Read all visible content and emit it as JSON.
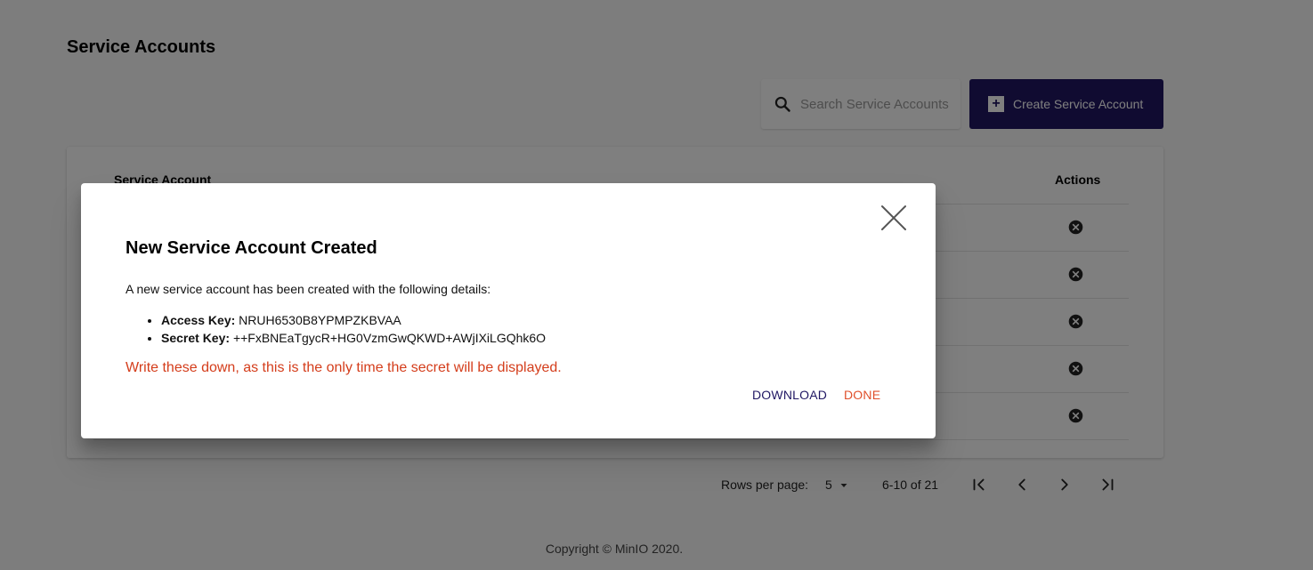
{
  "page": {
    "title": "Service Accounts"
  },
  "search": {
    "placeholder": "Search Service Accounts"
  },
  "toolbar": {
    "create_label": "Create Service Account"
  },
  "table": {
    "headers": {
      "account": "Service Account",
      "actions": "Actions"
    },
    "row_count_visible": 5
  },
  "pagination": {
    "rows_per_page_label": "Rows per page:",
    "rows_per_page_value": "5",
    "range_text": "6-10 of 21"
  },
  "footer": {
    "text": "Copyright © MinIO 2020."
  },
  "modal": {
    "title": "New Service Account Created",
    "description": "A new service account has been created with the following details:",
    "access_key_label": "Access Key:",
    "access_key_value": "NRUH6530B8YPMPZKBVAA",
    "secret_key_label": "Secret Key:",
    "secret_key_value": "++FxBNEaTgycR+HG0VzmGwQKWD+AWjIXiLGQhk6O",
    "warning": "Write these down, as this is the only time the secret will be displayed.",
    "download_label": "DOWNLOAD",
    "done_label": "DONE"
  },
  "colors": {
    "brand": "#201763",
    "warning": "#d43d1b",
    "done": "#e04f2a",
    "overlay": "rgba(0,0,0,0.5)"
  },
  "icons": {
    "search": "search-icon",
    "add": "plus-icon",
    "row_delete": "delete-circle-icon",
    "close": "close-icon",
    "first_page": "first-page-icon",
    "prev_page": "chevron-left-icon",
    "next_page": "chevron-right-icon",
    "last_page": "last-page-icon",
    "dropdown": "caret-down-icon"
  }
}
